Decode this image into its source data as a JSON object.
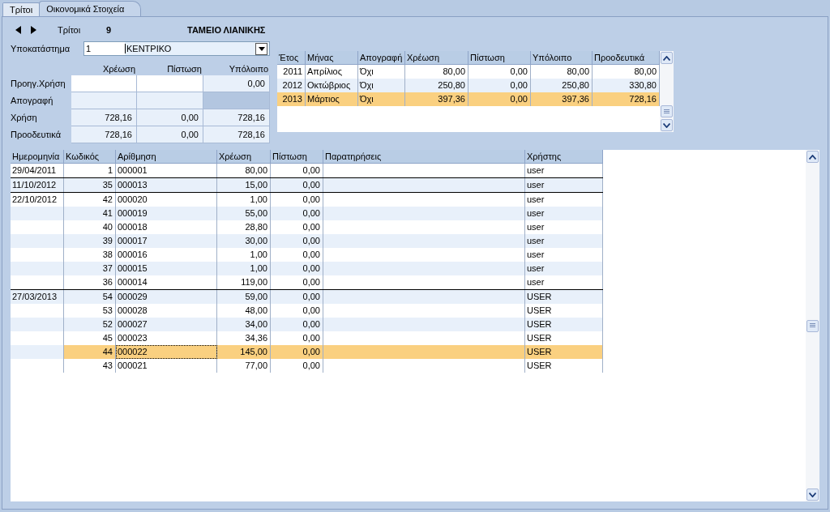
{
  "tabs": [
    {
      "label": "Τρίτοι",
      "selected": false
    },
    {
      "label": "Οικονομικά Στοιχεία",
      "selected": true
    }
  ],
  "header": {
    "label": "Τρίτοι",
    "number": "9",
    "name": "ΤΑΜΕΙΟ ΛΙΑΝΙΚΗΣ"
  },
  "branch": {
    "label": "Υποκατάστημα",
    "code": "1",
    "value": "ΚΕΝΤΡΙΚΟ"
  },
  "summary": {
    "columns": [
      "Χρέωση",
      "Πίστωση",
      "Υπόλοιπο"
    ],
    "rows": [
      {
        "label": "Προηγ.Χρήση",
        "cells": [
          {
            "kind": "input"
          },
          {
            "kind": "input"
          },
          {
            "kind": "readonly",
            "value": "0,00"
          }
        ]
      },
      {
        "label": "Απογραφή",
        "cells": [
          {
            "kind": "readonly"
          },
          {
            "kind": "readonly"
          },
          {
            "kind": "blank"
          }
        ]
      },
      {
        "label": "Χρήση",
        "cells": [
          {
            "kind": "readonly",
            "value": "728,16"
          },
          {
            "kind": "readonly",
            "value": "0,00"
          },
          {
            "kind": "readonly",
            "value": "728,16"
          }
        ]
      },
      {
        "label": "Προοδευτικά",
        "cells": [
          {
            "kind": "readonly",
            "value": "728,16"
          },
          {
            "kind": "readonly",
            "value": "0,00"
          },
          {
            "kind": "readonly",
            "value": "728,16"
          }
        ]
      }
    ]
  },
  "periods": {
    "columns": [
      "Έτος",
      "Μήνας",
      "Απογραφή",
      "Χρέωση",
      "Πίστωση",
      "Υπόλοιπο",
      "Προοδευτικά"
    ],
    "rows": [
      {
        "cells": [
          "2011",
          "Απρίλιος",
          "Όχι",
          "80,00",
          "0,00",
          "80,00",
          "80,00"
        ],
        "selected": false
      },
      {
        "cells": [
          "2012",
          "Οκτώβριος",
          "Όχι",
          "250,80",
          "0,00",
          "250,80",
          "330,80"
        ],
        "selected": false
      },
      {
        "cells": [
          "2013",
          "Μάρτιος",
          "Όχι",
          "397,36",
          "0,00",
          "397,36",
          "728,16"
        ],
        "selected": true
      }
    ]
  },
  "table": {
    "columns": [
      "Ημερομηνία",
      "Κωδικός",
      "Αρίθμηση",
      "Χρέωση",
      "Πίστωση",
      "Παρατηρήσεις",
      "Χρήστης"
    ],
    "rows": [
      {
        "date": "29/04/2011",
        "code": "1",
        "number": "000001",
        "debit": "80,00",
        "credit": "0,00",
        "user": "user",
        "selected": false
      },
      {
        "date": "11/10/2012",
        "code": "35",
        "number": "000013",
        "debit": "15,00",
        "credit": "0,00",
        "user": "user",
        "selected": false
      },
      {
        "date": "22/10/2012",
        "code": "42",
        "number": "000020",
        "debit": "1,00",
        "credit": "0,00",
        "user": "user",
        "selected": false
      },
      {
        "code": "41",
        "number": "000019",
        "debit": "55,00",
        "credit": "0,00",
        "user": "user",
        "selected": false
      },
      {
        "code": "40",
        "number": "000018",
        "debit": "28,80",
        "credit": "0,00",
        "user": "user",
        "selected": false
      },
      {
        "code": "39",
        "number": "000017",
        "debit": "30,00",
        "credit": "0,00",
        "user": "user",
        "selected": false
      },
      {
        "code": "38",
        "number": "000016",
        "debit": "1,00",
        "credit": "0,00",
        "user": "user",
        "selected": false
      },
      {
        "code": "37",
        "number": "000015",
        "debit": "1,00",
        "credit": "0,00",
        "user": "user",
        "selected": false
      },
      {
        "code": "36",
        "number": "000014",
        "debit": "119,00",
        "credit": "0,00",
        "user": "user",
        "selected": false
      },
      {
        "date": "27/03/2013",
        "code": "54",
        "number": "000029",
        "debit": "59,00",
        "credit": "0,00",
        "user": "USER",
        "selected": false
      },
      {
        "code": "53",
        "number": "000028",
        "debit": "48,00",
        "credit": "0,00",
        "user": "USER",
        "selected": false
      },
      {
        "code": "52",
        "number": "000027",
        "debit": "34,00",
        "credit": "0,00",
        "user": "USER",
        "selected": false
      },
      {
        "code": "45",
        "number": "000023",
        "debit": "34,36",
        "credit": "0,00",
        "user": "USER",
        "selected": false
      },
      {
        "code": "44",
        "number": "000022",
        "debit": "145,00",
        "credit": "0,00",
        "user": "USER",
        "selected": true
      },
      {
        "code": "43",
        "number": "000021",
        "debit": "77,00",
        "credit": "0,00",
        "user": "USER",
        "selected": false
      }
    ]
  }
}
